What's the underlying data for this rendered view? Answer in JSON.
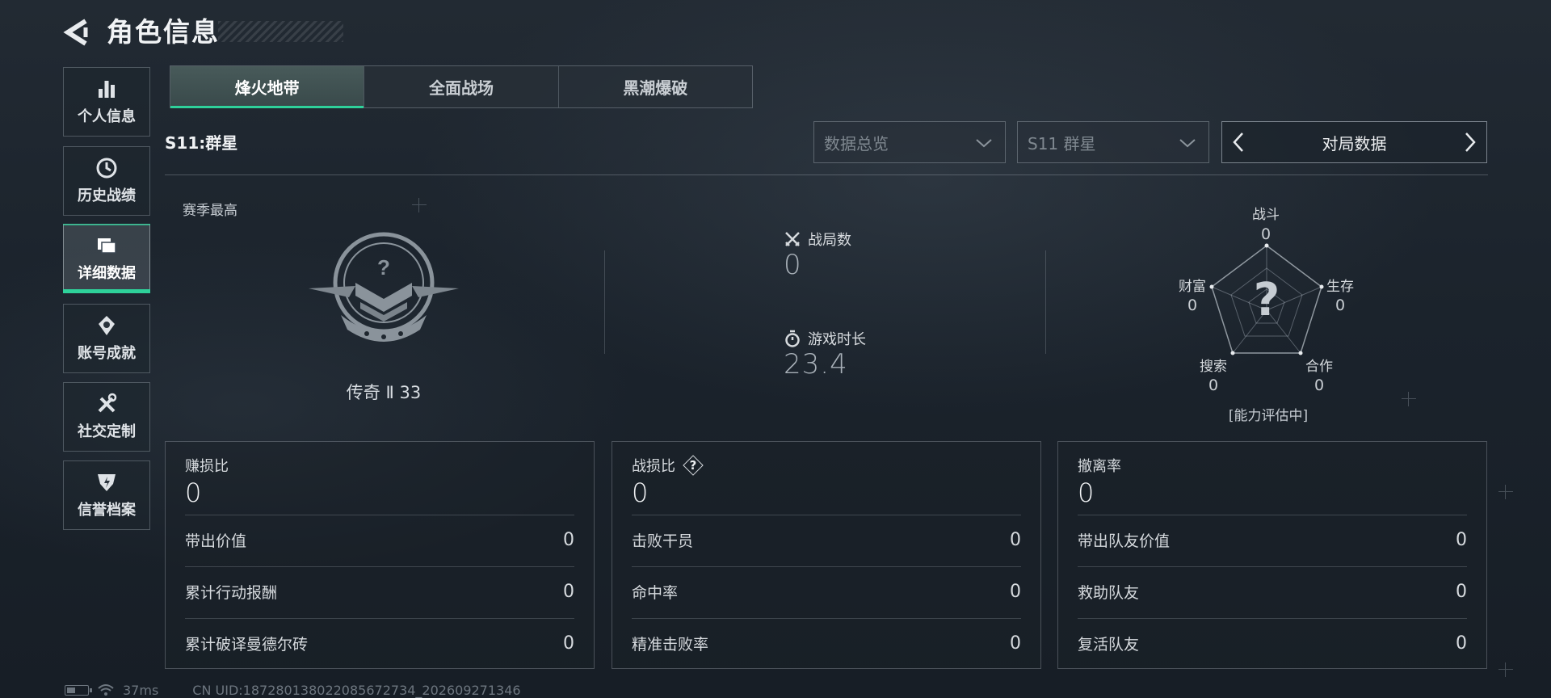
{
  "header": {
    "title": "角色信息"
  },
  "sidebar": {
    "items": [
      {
        "label": "个人信息",
        "icon": "bar-chart-icon"
      },
      {
        "label": "历史战绩",
        "icon": "clock-icon"
      },
      {
        "label": "详细数据",
        "icon": "folder-icon",
        "active": true
      },
      {
        "label": "账号成就",
        "icon": "achievement-icon"
      },
      {
        "label": "社交定制",
        "icon": "tools-icon"
      },
      {
        "label": "信誉档案",
        "icon": "credit-shield-icon"
      }
    ]
  },
  "tabs": [
    {
      "label": "烽火地带",
      "active": true
    },
    {
      "label": "全面战场"
    },
    {
      "label": "黑潮爆破"
    }
  ],
  "season": {
    "label": "S11:群星"
  },
  "filters": {
    "data_view": "数据总览",
    "season_select": "S11 群星",
    "mode": "对局数据"
  },
  "overview": {
    "season_high_label": "赛季最高",
    "rank_text": "传奇 Ⅱ 33",
    "matches_label": "战局数",
    "matches_value": "0",
    "playtime_label": "游戏时长",
    "playtime_value": "23.4"
  },
  "radar": {
    "axes": [
      {
        "label": "战斗",
        "value": "0"
      },
      {
        "label": "生存",
        "value": "0"
      },
      {
        "label": "合作",
        "value": "0"
      },
      {
        "label": "搜索",
        "value": "0"
      },
      {
        "label": "财富",
        "value": "0"
      }
    ],
    "center_mark": "?",
    "status": "[能力评估中]"
  },
  "panels": [
    {
      "title": "赚损比",
      "value": "0",
      "rows": [
        {
          "label": "带出价值",
          "value": "0"
        },
        {
          "label": "累计行动报酬",
          "value": "0"
        },
        {
          "label": "累计破译曼德尔砖",
          "value": "0"
        }
      ]
    },
    {
      "title": "战损比",
      "value": "0",
      "help": "?",
      "rows": [
        {
          "label": "击败干员",
          "value": "0"
        },
        {
          "label": "命中率",
          "value": "0"
        },
        {
          "label": "精准击败率",
          "value": "0"
        }
      ]
    },
    {
      "title": "撤离率",
      "value": "0",
      "rows": [
        {
          "label": "带出队友价值",
          "value": "0"
        },
        {
          "label": "救助队友",
          "value": "0"
        },
        {
          "label": "复活队友",
          "value": "0"
        }
      ]
    }
  ],
  "status_bar": {
    "ping": "37ms",
    "uid": "CN UID:18728013802208567​2734_202609271346"
  },
  "colors": {
    "accent": "#2ed19a",
    "background": "#1d252e"
  }
}
